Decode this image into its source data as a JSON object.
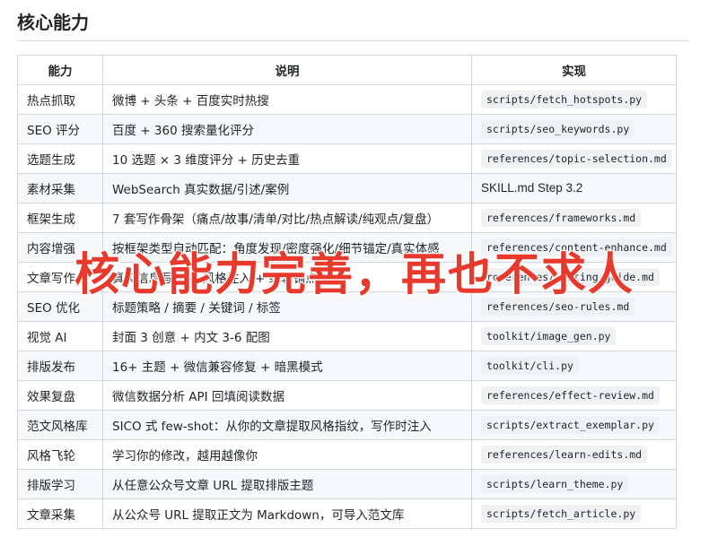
{
  "section": {
    "title": "核心能力"
  },
  "table": {
    "headers": [
      "能力",
      "说明",
      "实现"
    ],
    "rows": [
      {
        "capability": "热点抓取",
        "description": "微博 + 头条 + 百度实时热搜",
        "implementation": "scripts/fetch_hotspots.py",
        "impl_code": true
      },
      {
        "capability": "SEO 评分",
        "description": "百度 + 360 搜索量化评分",
        "implementation": "scripts/seo_keywords.py",
        "impl_code": true
      },
      {
        "capability": "选题生成",
        "description": "10 选题 × 3 维度评分 + 历史去重",
        "implementation": "references/topic-selection.md",
        "impl_code": true
      },
      {
        "capability": "素材采集",
        "description": "WebSearch 真实数据/引述/案例",
        "implementation": "SKILL.md Step 3.2",
        "impl_code": false
      },
      {
        "capability": "框架生成",
        "description": "7 套写作骨架（痛点/故事/清单/对比/热点解读/纯观点/复盘）",
        "implementation": "references/frameworks.md",
        "impl_code": true
      },
      {
        "capability": "内容增强",
        "description": "按框架类型自动匹配：角度发现/密度强化/细节锚定/真实体感",
        "implementation": "references/content-enhance.md",
        "impl_code": true
      },
      {
        "capability": "文章写作",
        "description": "真实信息写作 + 风格注入 + 编辑锚点",
        "implementation": "references/writing-guide.md",
        "impl_code": true
      },
      {
        "capability": "SEO 优化",
        "description": "标题策略 / 摘要 / 关键词 / 标签",
        "implementation": "references/seo-rules.md",
        "impl_code": true
      },
      {
        "capability": "视觉 AI",
        "description": "封面 3 创意 + 内文 3-6 配图",
        "implementation": "toolkit/image_gen.py",
        "impl_code": true
      },
      {
        "capability": "排版发布",
        "description": "16+ 主题 + 微信兼容修复 + 暗黑模式",
        "implementation": "toolkit/cli.py",
        "impl_code": true
      },
      {
        "capability": "效果复盘",
        "description": "微信数据分析 API 回填阅读数据",
        "implementation": "references/effect-review.md",
        "impl_code": true
      },
      {
        "capability": "范文风格库",
        "description": "SICO 式 few-shot：从你的文章提取风格指纹，写作时注入",
        "implementation": "scripts/extract_exemplar.py",
        "impl_code": true
      },
      {
        "capability": "风格飞轮",
        "description": "学习你的修改，越用越像你",
        "implementation": "references/learn-edits.md",
        "impl_code": true
      },
      {
        "capability": "排版学习",
        "description": "从任意公众号文章 URL 提取排版主题",
        "implementation": "scripts/learn_theme.py",
        "impl_code": true
      },
      {
        "capability": "文章采集",
        "description": "从公众号 URL 提取正文为 Markdown，可导入范文库",
        "implementation": "scripts/fetch_article.py",
        "impl_code": true
      }
    ]
  },
  "overlay": {
    "caption": "核心能力完善，再也不求人",
    "color": "#e8392d"
  }
}
